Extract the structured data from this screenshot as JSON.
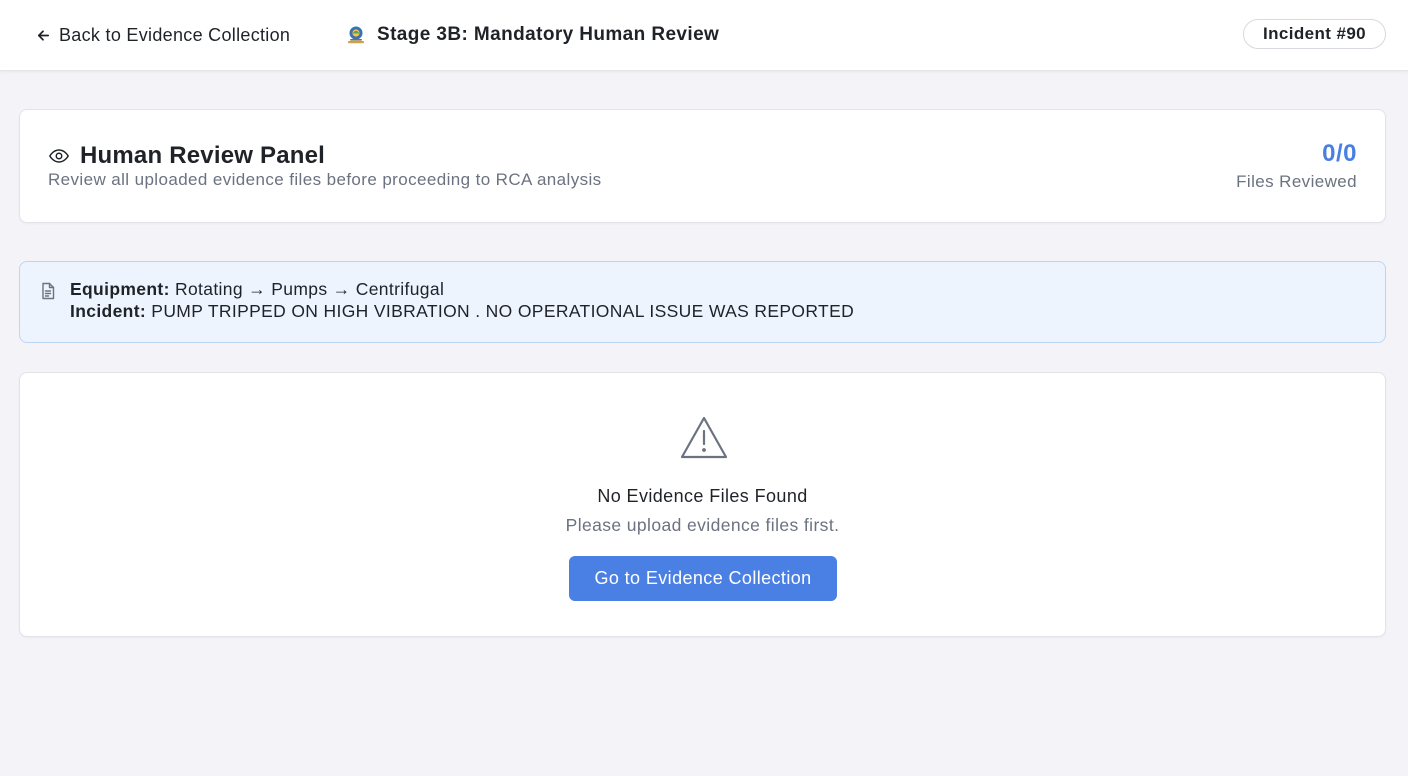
{
  "header": {
    "back_label": "Back to Evidence Collection",
    "back_icon": "arrow-left-icon",
    "logo_icon": "app-logo",
    "stage_title": "Stage 3B: Mandatory Human Review",
    "incident_badge": "Incident #90"
  },
  "review_panel": {
    "icon": "eye-icon",
    "title": "Human Review Panel",
    "subtitle": "Review all uploaded evidence files before proceeding to RCA analysis",
    "count": "0/0",
    "count_label": "Files Reviewed",
    "count_color": "#4a7fe0"
  },
  "info": {
    "icon": "document-icon",
    "equipment_label": "Equipment:",
    "equipment_value": "Rotating → Pumps → Centrifugal",
    "incident_label": "Incident:",
    "incident_value": "PUMP TRIPPED ON HIGH VIBRATION . NO OPERATIONAL ISSUE WAS REPORTED"
  },
  "empty_state": {
    "icon": "warning-triangle-icon",
    "title": "No Evidence Files Found",
    "message": "Please upload evidence files first.",
    "button_label": "Go to Evidence Collection",
    "button_color": "#4a80e4"
  }
}
